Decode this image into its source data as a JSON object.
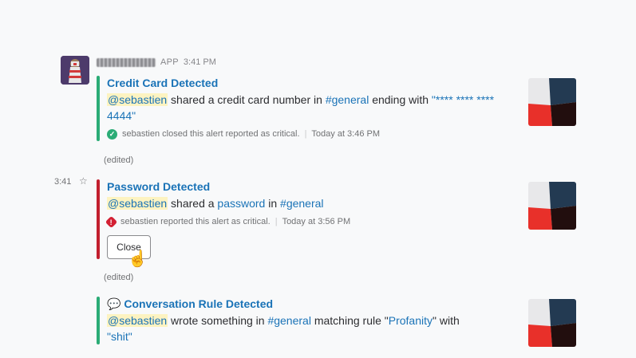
{
  "message": {
    "app_badge": "APP",
    "time": "3:41 PM",
    "hover_time": "3:41",
    "avatar_icon": "lighthouse-icon",
    "sender_name_obscured": true
  },
  "attachments": [
    {
      "title": "Credit Card Detected",
      "bar_color": "#2bac76",
      "text": {
        "mention": "@sebastien",
        "t1": " shared a credit card number in ",
        "channel": "#general",
        "t2": " ending with ",
        "value": "\"**** **** **** 4444\""
      },
      "footer": {
        "status_icon": "check-circle-icon",
        "status": "sebastien closed this alert reported as critical.",
        "time": "Today at 3:46 PM"
      },
      "edited": "(edited)"
    },
    {
      "title": "Password Detected",
      "bar_color": "#c21f2e",
      "text": {
        "mention": "@sebastien",
        "t1": " shared a ",
        "link": "password",
        "t2": " in ",
        "channel": "#general"
      },
      "footer": {
        "status_icon": "critical-alert-icon",
        "status": "sebastien reported this alert as critical.",
        "time": "Today at 3:56 PM"
      },
      "button": "Close",
      "edited": "(edited)"
    },
    {
      "title_emoji": "💬",
      "title": "Conversation Rule Detected",
      "bar_color": "#2bac76",
      "text": {
        "mention": "@sebastien",
        "t1": " wrote something in ",
        "channel": "#general",
        "t2": " matching rule \"",
        "rule": "Profanity",
        "t3": "\" with",
        "value": "\"shit\""
      }
    }
  ]
}
